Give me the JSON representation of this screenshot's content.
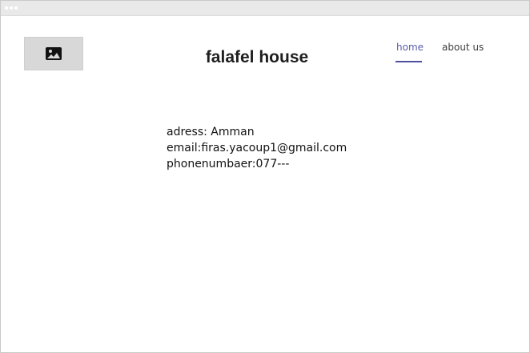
{
  "header": {
    "logo_icon": "image-placeholder-icon",
    "title": "falafel house"
  },
  "nav": {
    "items": [
      {
        "label": "home",
        "active": true
      },
      {
        "label": "about us",
        "active": false
      }
    ],
    "active_color": "#5a5ea8"
  },
  "contact": {
    "address": "adress: Amman",
    "email": "email:firas.yacoup1@gmail.com",
    "phone": "phonenumbaer:077---"
  }
}
